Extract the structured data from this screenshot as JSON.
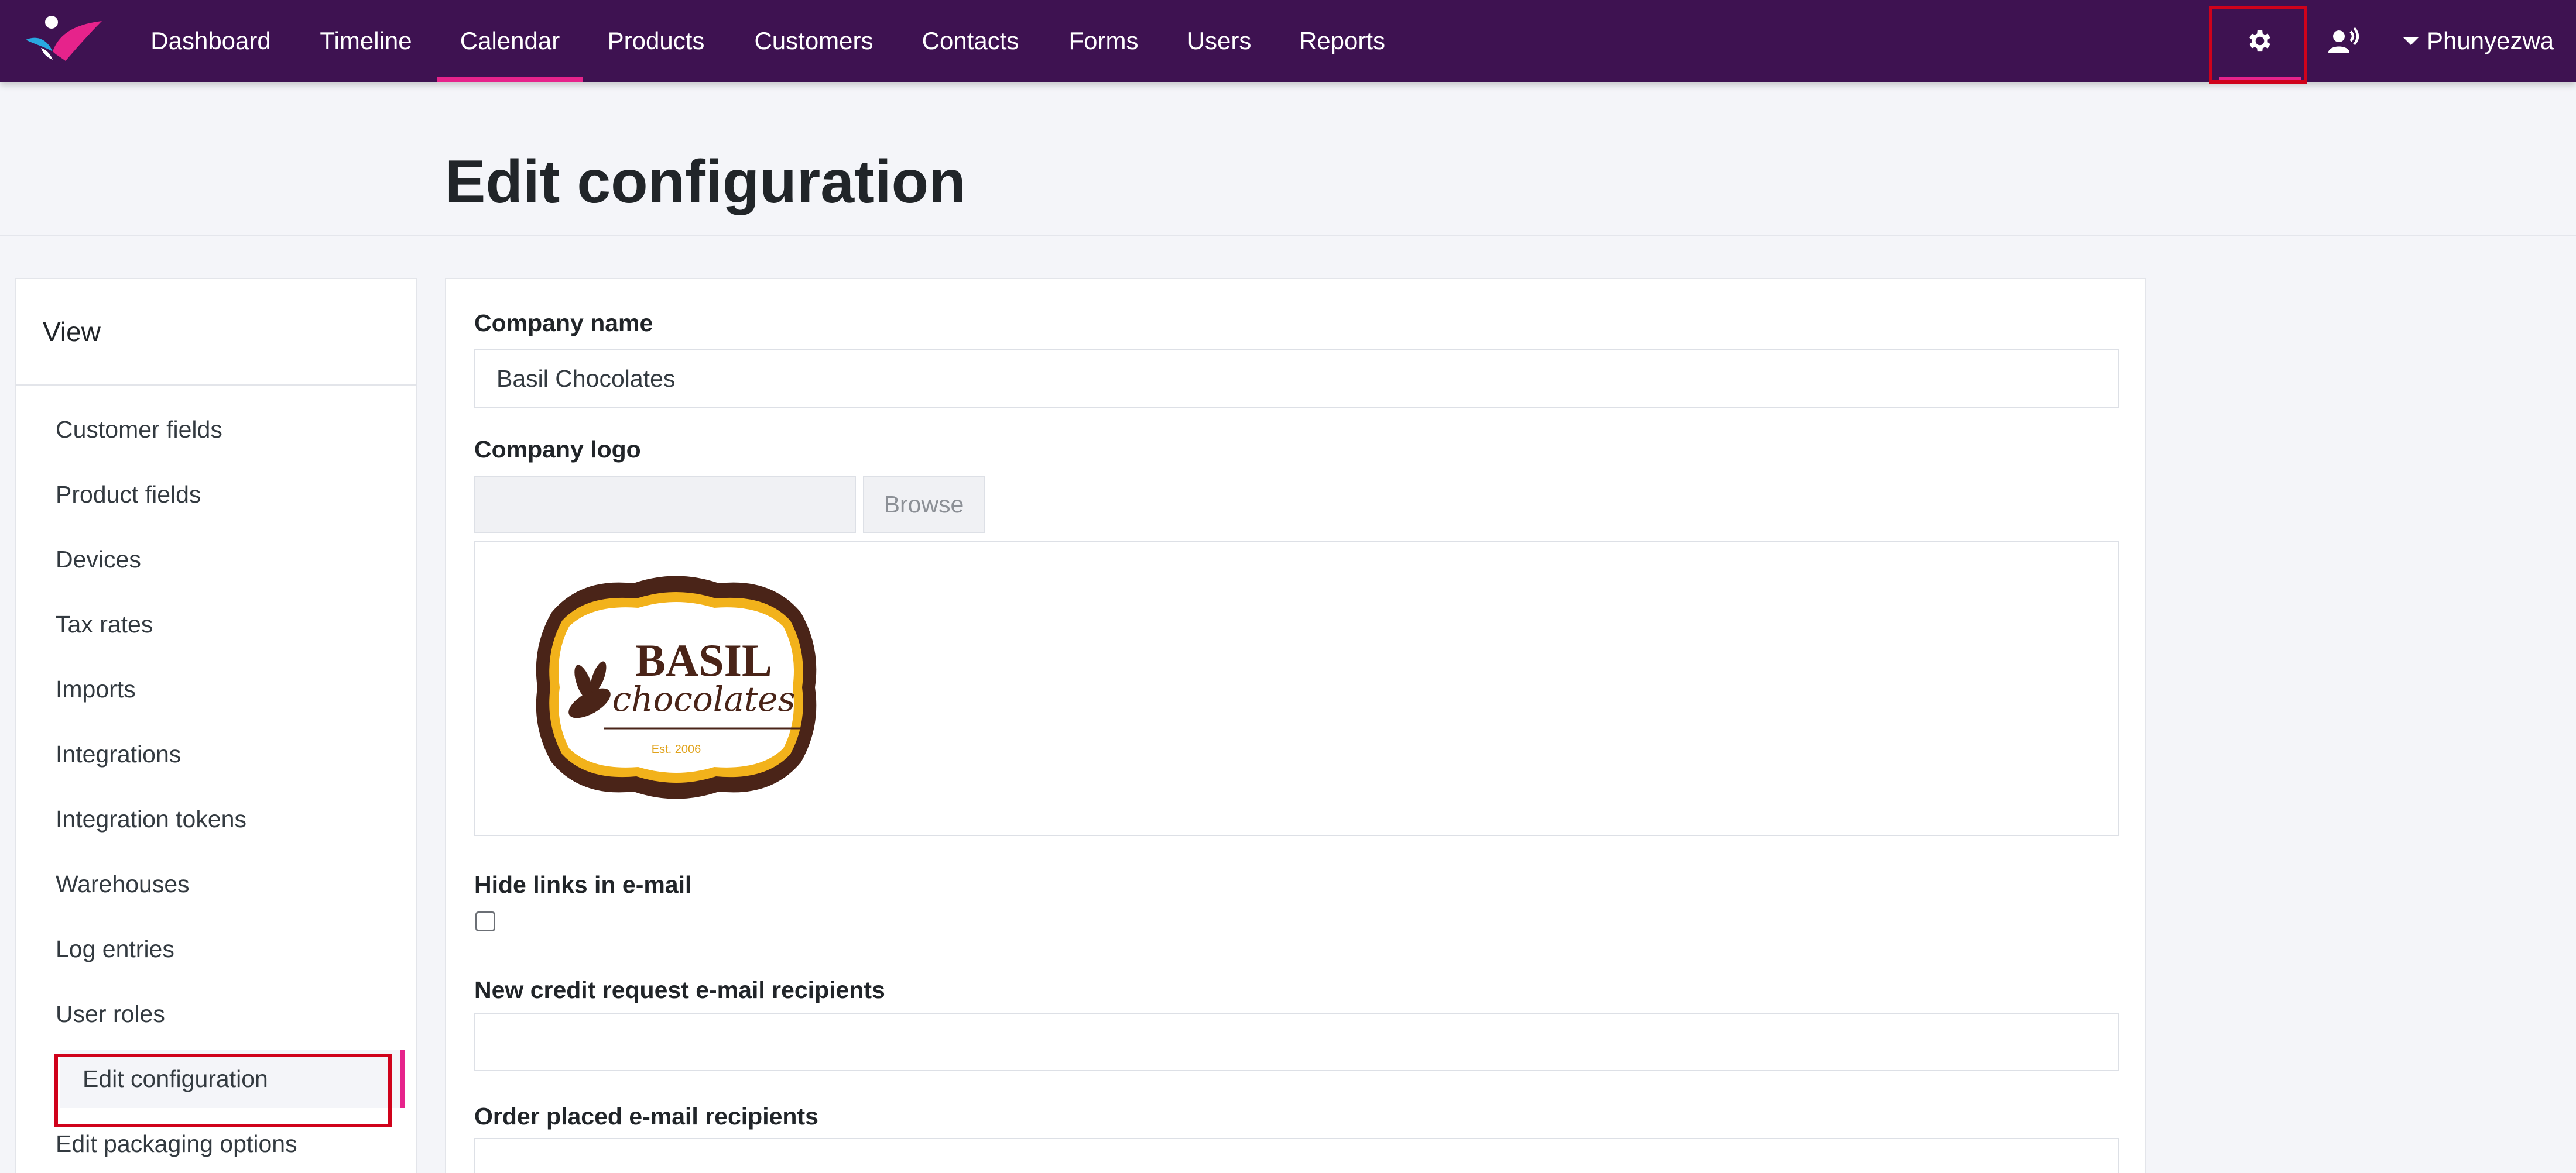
{
  "nav": {
    "items": [
      {
        "label": "Dashboard"
      },
      {
        "label": "Timeline"
      },
      {
        "label": "Calendar"
      },
      {
        "label": "Products"
      },
      {
        "label": "Customers"
      },
      {
        "label": "Contacts"
      },
      {
        "label": "Forms"
      },
      {
        "label": "Users"
      },
      {
        "label": "Reports"
      }
    ],
    "active": "Calendar",
    "settings_icon": "gear-icon",
    "voice_icon": "user-voice-icon",
    "user_name": "Phunyezwa"
  },
  "page": {
    "title": "Edit configuration"
  },
  "sidebar": {
    "title": "View",
    "items": [
      {
        "label": "Customer fields"
      },
      {
        "label": "Product fields"
      },
      {
        "label": "Devices"
      },
      {
        "label": "Tax rates"
      },
      {
        "label": "Imports"
      },
      {
        "label": "Integrations"
      },
      {
        "label": "Integration tokens"
      },
      {
        "label": "Warehouses"
      },
      {
        "label": "Log entries"
      },
      {
        "label": "User roles"
      },
      {
        "label": "Edit configuration"
      },
      {
        "label": "Edit packaging options"
      }
    ],
    "active": "Edit configuration"
  },
  "form": {
    "company_name_label": "Company name",
    "company_name_value": "Basil Chocolates",
    "company_logo_label": "Company logo",
    "browse_label": "Browse",
    "logo_text": {
      "line1": "BASIL",
      "line2": "chocolates",
      "line3": "Est. 2006"
    },
    "hide_links_label": "Hide links in e-mail",
    "hide_links_checked": false,
    "credit_request_label": "New credit request e-mail recipients",
    "credit_request_value": "",
    "order_placed_label": "Order placed e-mail recipients",
    "order_placed_value": ""
  },
  "colors": {
    "nav_bg": "#3e1251",
    "accent": "#e6238b",
    "highlight_box": "#d0021b",
    "page_bg": "#f4f5f9"
  }
}
